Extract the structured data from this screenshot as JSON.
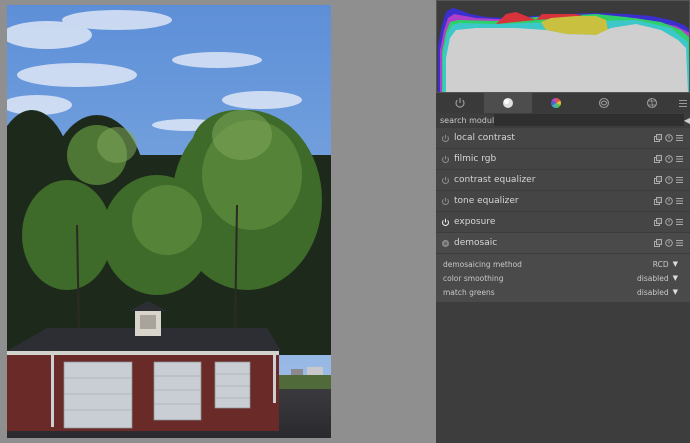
{
  "search": {
    "label": "search module",
    "value": "",
    "clear_glyph": "◀"
  },
  "tabs": [
    {
      "icon": "power-icon",
      "active": false
    },
    {
      "icon": "circle-base-icon",
      "active": true
    },
    {
      "icon": "color-wheel-icon",
      "active": false
    },
    {
      "icon": "correct-icon",
      "active": false
    },
    {
      "icon": "effect-icon",
      "active": false
    }
  ],
  "modules": [
    {
      "name": "local contrast",
      "enabled": false
    },
    {
      "name": "filmic rgb",
      "enabled": false
    },
    {
      "name": "contrast equalizer",
      "enabled": false
    },
    {
      "name": "tone equalizer",
      "enabled": false
    },
    {
      "name": "exposure",
      "enabled": true
    },
    {
      "name": "demosaic",
      "enabled": true,
      "expanded": true
    }
  ],
  "demosaic": {
    "params": [
      {
        "label": "demosaicing method",
        "value": "RCD"
      },
      {
        "label": "color smoothing",
        "value": "disabled"
      },
      {
        "label": "match greens",
        "value": "disabled"
      }
    ]
  },
  "colors": {
    "panel": "#3d3d3d",
    "module_bg": "#454545",
    "histogram_blue": "#3b2fd0",
    "histogram_green": "#2fcf6a",
    "histogram_red": "#d8333a",
    "histogram_yellow": "#c9c040",
    "histogram_cyan": "#3cc8c8",
    "histogram_magenta": "#b040c8"
  }
}
